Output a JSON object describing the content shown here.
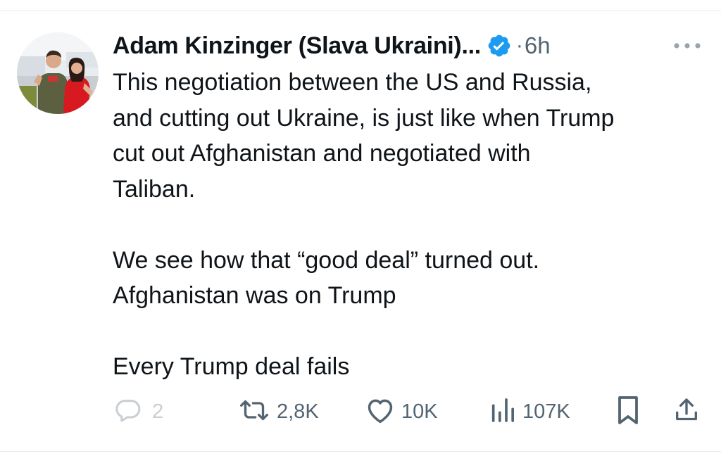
{
  "tweet": {
    "display_name": "Adam Kinzinger (Slava Ukraini)...",
    "time_separator": "·",
    "timestamp": "6h",
    "paragraphs": [
      [
        "This negotiation between the US and Russia,",
        "and cutting out Ukraine, is just like when Trump",
        "cut out Afghanistan and negotiated with",
        "Taliban."
      ],
      [
        "We see how that “good deal” turned out.",
        "Afghanistan was on Trump"
      ],
      [
        "Every Trump deal fails"
      ]
    ]
  },
  "actions": {
    "replies": "2",
    "reposts": "2,8K",
    "likes": "10K",
    "views": "107K"
  },
  "icons": {
    "verified": "verified-badge-icon",
    "more": "more-horizontal-icon",
    "reply": "reply-bubble-icon",
    "repost": "repost-icon",
    "like": "heart-icon",
    "views": "views-bar-chart-icon",
    "bookmark": "bookmark-icon",
    "share": "share-upload-icon"
  },
  "colors": {
    "text": "#0f1419",
    "secondary": "#536471",
    "verified_blue": "#1d9bf0",
    "faded": "#c7ced4"
  }
}
